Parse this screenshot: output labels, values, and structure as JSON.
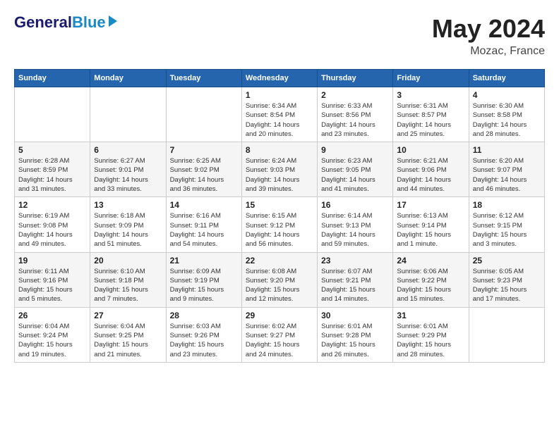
{
  "header": {
    "logo_line1": "General",
    "logo_line2": "Blue",
    "month": "May 2024",
    "location": "Mozac, France"
  },
  "days_of_week": [
    "Sunday",
    "Monday",
    "Tuesday",
    "Wednesday",
    "Thursday",
    "Friday",
    "Saturday"
  ],
  "weeks": [
    [
      {
        "num": "",
        "info": ""
      },
      {
        "num": "",
        "info": ""
      },
      {
        "num": "",
        "info": ""
      },
      {
        "num": "1",
        "info": "Sunrise: 6:34 AM\nSunset: 8:54 PM\nDaylight: 14 hours\nand 20 minutes."
      },
      {
        "num": "2",
        "info": "Sunrise: 6:33 AM\nSunset: 8:56 PM\nDaylight: 14 hours\nand 23 minutes."
      },
      {
        "num": "3",
        "info": "Sunrise: 6:31 AM\nSunset: 8:57 PM\nDaylight: 14 hours\nand 25 minutes."
      },
      {
        "num": "4",
        "info": "Sunrise: 6:30 AM\nSunset: 8:58 PM\nDaylight: 14 hours\nand 28 minutes."
      }
    ],
    [
      {
        "num": "5",
        "info": "Sunrise: 6:28 AM\nSunset: 8:59 PM\nDaylight: 14 hours\nand 31 minutes."
      },
      {
        "num": "6",
        "info": "Sunrise: 6:27 AM\nSunset: 9:01 PM\nDaylight: 14 hours\nand 33 minutes."
      },
      {
        "num": "7",
        "info": "Sunrise: 6:25 AM\nSunset: 9:02 PM\nDaylight: 14 hours\nand 36 minutes."
      },
      {
        "num": "8",
        "info": "Sunrise: 6:24 AM\nSunset: 9:03 PM\nDaylight: 14 hours\nand 39 minutes."
      },
      {
        "num": "9",
        "info": "Sunrise: 6:23 AM\nSunset: 9:05 PM\nDaylight: 14 hours\nand 41 minutes."
      },
      {
        "num": "10",
        "info": "Sunrise: 6:21 AM\nSunset: 9:06 PM\nDaylight: 14 hours\nand 44 minutes."
      },
      {
        "num": "11",
        "info": "Sunrise: 6:20 AM\nSunset: 9:07 PM\nDaylight: 14 hours\nand 46 minutes."
      }
    ],
    [
      {
        "num": "12",
        "info": "Sunrise: 6:19 AM\nSunset: 9:08 PM\nDaylight: 14 hours\nand 49 minutes."
      },
      {
        "num": "13",
        "info": "Sunrise: 6:18 AM\nSunset: 9:09 PM\nDaylight: 14 hours\nand 51 minutes."
      },
      {
        "num": "14",
        "info": "Sunrise: 6:16 AM\nSunset: 9:11 PM\nDaylight: 14 hours\nand 54 minutes."
      },
      {
        "num": "15",
        "info": "Sunrise: 6:15 AM\nSunset: 9:12 PM\nDaylight: 14 hours\nand 56 minutes."
      },
      {
        "num": "16",
        "info": "Sunrise: 6:14 AM\nSunset: 9:13 PM\nDaylight: 14 hours\nand 59 minutes."
      },
      {
        "num": "17",
        "info": "Sunrise: 6:13 AM\nSunset: 9:14 PM\nDaylight: 15 hours\nand 1 minute."
      },
      {
        "num": "18",
        "info": "Sunrise: 6:12 AM\nSunset: 9:15 PM\nDaylight: 15 hours\nand 3 minutes."
      }
    ],
    [
      {
        "num": "19",
        "info": "Sunrise: 6:11 AM\nSunset: 9:16 PM\nDaylight: 15 hours\nand 5 minutes."
      },
      {
        "num": "20",
        "info": "Sunrise: 6:10 AM\nSunset: 9:18 PM\nDaylight: 15 hours\nand 7 minutes."
      },
      {
        "num": "21",
        "info": "Sunrise: 6:09 AM\nSunset: 9:19 PM\nDaylight: 15 hours\nand 9 minutes."
      },
      {
        "num": "22",
        "info": "Sunrise: 6:08 AM\nSunset: 9:20 PM\nDaylight: 15 hours\nand 12 minutes."
      },
      {
        "num": "23",
        "info": "Sunrise: 6:07 AM\nSunset: 9:21 PM\nDaylight: 15 hours\nand 14 minutes."
      },
      {
        "num": "24",
        "info": "Sunrise: 6:06 AM\nSunset: 9:22 PM\nDaylight: 15 hours\nand 15 minutes."
      },
      {
        "num": "25",
        "info": "Sunrise: 6:05 AM\nSunset: 9:23 PM\nDaylight: 15 hours\nand 17 minutes."
      }
    ],
    [
      {
        "num": "26",
        "info": "Sunrise: 6:04 AM\nSunset: 9:24 PM\nDaylight: 15 hours\nand 19 minutes."
      },
      {
        "num": "27",
        "info": "Sunrise: 6:04 AM\nSunset: 9:25 PM\nDaylight: 15 hours\nand 21 minutes."
      },
      {
        "num": "28",
        "info": "Sunrise: 6:03 AM\nSunset: 9:26 PM\nDaylight: 15 hours\nand 23 minutes."
      },
      {
        "num": "29",
        "info": "Sunrise: 6:02 AM\nSunset: 9:27 PM\nDaylight: 15 hours\nand 24 minutes."
      },
      {
        "num": "30",
        "info": "Sunrise: 6:01 AM\nSunset: 9:28 PM\nDaylight: 15 hours\nand 26 minutes."
      },
      {
        "num": "31",
        "info": "Sunrise: 6:01 AM\nSunset: 9:29 PM\nDaylight: 15 hours\nand 28 minutes."
      },
      {
        "num": "",
        "info": ""
      }
    ]
  ]
}
